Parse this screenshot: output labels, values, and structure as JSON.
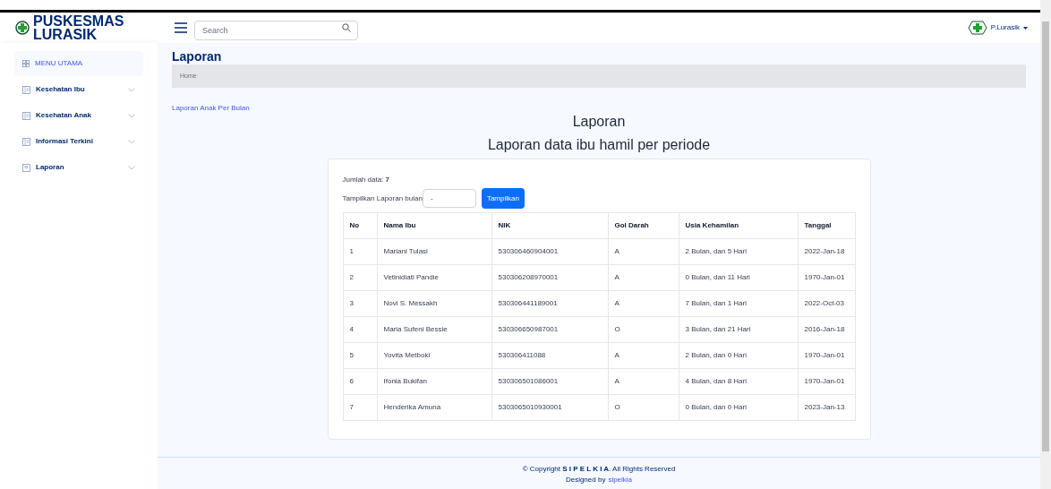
{
  "header": {
    "brand": "PUSKESMAS LURASIK",
    "search": {
      "placeholder": "Search"
    },
    "user": "P.Lurasik"
  },
  "sidebar": {
    "items": [
      {
        "kind": "heading",
        "label": "MENU UTAMA",
        "selected": true
      },
      {
        "kind": "menu",
        "label": "Kesehatan Ibu",
        "selected": false
      },
      {
        "kind": "menu",
        "label": "Kesehatan Anak",
        "selected": false
      },
      {
        "kind": "menu",
        "label": "Informasi Terkini",
        "selected": false
      },
      {
        "kind": "report",
        "label": "Laporan",
        "selected": false
      }
    ]
  },
  "page": {
    "title": "Laporan",
    "breadcrumb": "Home",
    "link": "Laporan Anak Per Bulan",
    "heading": "Laporan",
    "subheading": "Laporan data ibu hamil per periode"
  },
  "report": {
    "count_label": "Jumlah data: **7**",
    "filter_label": "Tampilkan Laporan bulan",
    "filter_value": "-",
    "button": "Tampilkan",
    "table": {
      "columns": [
        "No",
        "Nama Ibu",
        "NIK",
        "Gol Darah",
        "Usia Kehamilan",
        "Tanggal"
      ],
      "rows": [
        [
          "1",
          "Mariani Tulasi",
          "530306460904001",
          "A",
          "2 Bulan, dan 5 Hari",
          "2022-Jan-18"
        ],
        [
          "2",
          "Vetinidiati Pandie",
          "530306208970001",
          "A",
          "0 Bulan, dan 11 Hari",
          "1970-Jan-01"
        ],
        [
          "3",
          "Novi S. Messakh",
          "530306441189001",
          "A",
          "7 Bulan, dan 1 Hari",
          "2022-Oct-03"
        ],
        [
          "4",
          "Maria Sufeni Bessie",
          "530306650987001",
          "O",
          "3 Bulan, dan 21 Hari",
          "2016-Jan-18"
        ],
        [
          "5",
          "Yovita Metboki",
          "530306411088",
          "A",
          "2 Bulan, dan 0 Hari",
          "1970-Jan-01"
        ],
        [
          "6",
          "Ifonia Bukifan",
          "530306501086001",
          "A",
          "4 Bulan, dan 8 Hari",
          "1970-Jan-01"
        ],
        [
          "7",
          "Henderika Amuna",
          "5303065010930001",
          "O",
          "0 Bulan, dan 0 Hari",
          "2023-Jan-13"
        ]
      ]
    }
  },
  "footer": {
    "copyright": "© Copyright **S I P E L K I A**. All Rights Reserved",
    "designed": "Designed by",
    "designed_link": "sipelkia"
  }
}
